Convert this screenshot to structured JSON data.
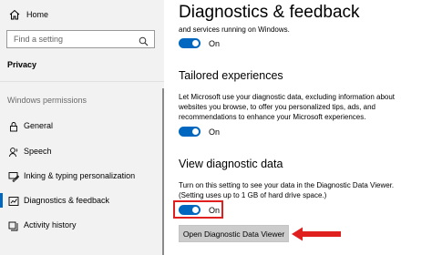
{
  "sidebar": {
    "home_label": "Home",
    "search": {
      "placeholder": "Find a setting"
    },
    "section_title": "Privacy",
    "permissions_header": "Windows permissions",
    "items": [
      {
        "label": "General",
        "icon": "lock-icon"
      },
      {
        "label": "Speech",
        "icon": "speech-icon"
      },
      {
        "label": "Inking & typing personalization",
        "icon": "inking-icon"
      },
      {
        "label": "Diagnostics & feedback",
        "icon": "diagnostics-icon",
        "active": true
      },
      {
        "label": "Activity history",
        "icon": "activity-history-icon"
      }
    ]
  },
  "main": {
    "title": "Diagnostics & feedback",
    "top_text": "and services running on Windows.",
    "top_toggle": {
      "state": "On"
    },
    "tailored": {
      "heading": "Tailored experiences",
      "lines": [
        "Let Microsoft use your diagnostic data, excluding information about",
        "websites you browse, to offer you personalized tips, ads, and",
        "recommendations to enhance your Microsoft experiences."
      ],
      "toggle": {
        "state": "On"
      }
    },
    "view_data": {
      "heading": "View diagnostic data",
      "lines": [
        "Turn on this setting to see your data in the Diagnostic Data Viewer.",
        "(Setting uses up to 1 GB of hard drive space.)"
      ],
      "toggle": {
        "state": "On"
      },
      "button_label": "Open Diagnostic Data Viewer"
    }
  },
  "colors": {
    "accent": "#0067c0",
    "annotation": "#e0201f",
    "sidebar_bg": "#f2f2f2",
    "button_bg": "#cccccc"
  }
}
